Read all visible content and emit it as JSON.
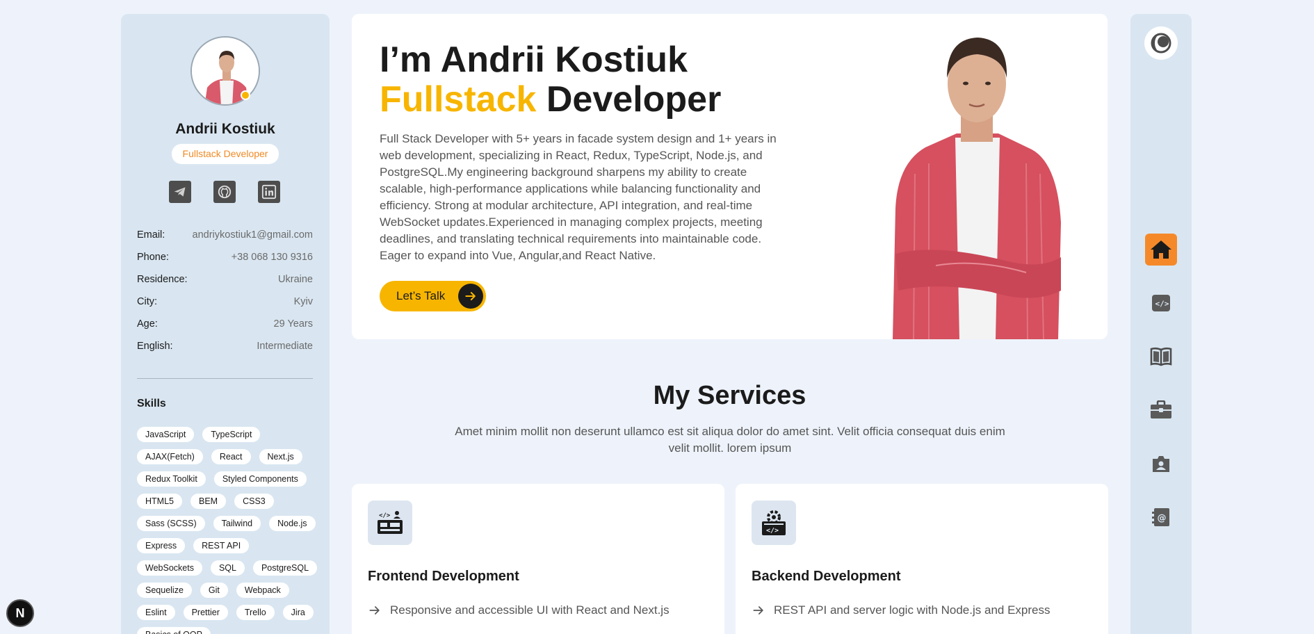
{
  "profile": {
    "name": "Andrii Kostiuk",
    "role": "Fullstack Developer",
    "status_color": "#f7b500",
    "socials": [
      {
        "icon": "telegram-icon"
      },
      {
        "icon": "github-icon"
      },
      {
        "icon": "linkedin-icon"
      }
    ],
    "info": [
      {
        "label": "Email:",
        "value": "andriykostiuk1@gmail.com"
      },
      {
        "label": "Phone:",
        "value": "+38 068 130 9316"
      },
      {
        "label": "Residence:",
        "value": "Ukraine"
      },
      {
        "label": "City:",
        "value": "Kyiv"
      },
      {
        "label": "Age:",
        "value": "29 Years"
      },
      {
        "label": "English:",
        "value": "Intermediate"
      }
    ],
    "skills_title": "Skills",
    "skills": [
      "JavaScript",
      "TypeScript",
      "AJAX(Fetch)",
      "React",
      "Next.js",
      "Redux Toolkit",
      "Styled Components",
      "HTML5",
      "BEM",
      "CSS3",
      "Sass (SCSS)",
      "Tailwind",
      "Node.js",
      "Express",
      "REST API",
      "WebSockets",
      "SQL",
      "PostgreSQL",
      "Sequelize",
      "Git",
      "Webpack",
      "Eslint",
      "Prettier",
      "Trello",
      "Jira",
      "Basics of OOP"
    ]
  },
  "hero": {
    "title_line1": "I’m Andrii Kostiuk",
    "title_accent": "Fullstack",
    "title_rest": "Developer",
    "description": "Full Stack Developer with 5+ years in facade system design and 1+ years in web development, specializing in React, Redux, TypeScript, Node.js, and PostgreSQL.My engineering background sharpens my ability to create scalable, high-performance applications while balancing functionality and efficiency. Strong at modular architecture, API integration, and real-time WebSocket updates.Experienced in managing complex projects, meeting deadlines, and translating technical requirements into maintainable code. Eager to expand into Vue, Angular,and React Native.",
    "cta_label": "Let’s Talk"
  },
  "services": {
    "title": "My Services",
    "subtitle": "Amet minim mollit non deserunt ullamco est sit aliqua dolor do amet sint. Velit officia consequat duis enim velit mollit. lorem ipsum",
    "items": [
      {
        "name": "Frontend Development",
        "point": "Responsive and accessible UI with React and Next.js",
        "icon": "frontend-dev-icon"
      },
      {
        "name": "Backend Development",
        "point": "REST API and server logic with Node.js and Express",
        "icon": "backend-dev-icon"
      }
    ]
  },
  "nav": {
    "items": [
      "home-icon",
      "code-icon",
      "book-icon",
      "briefcase-icon",
      "portfolio-icon",
      "contact-icon"
    ],
    "active": "home-icon",
    "accent": "#f5892a"
  },
  "badge": {
    "label": "N"
  }
}
